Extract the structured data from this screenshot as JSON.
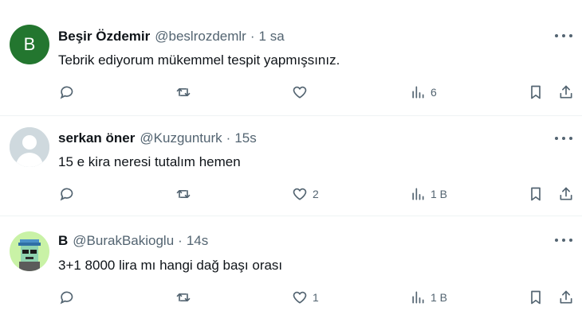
{
  "tweets": [
    {
      "name": "Beşir Özdemir",
      "handle": "@beslrozdemlr",
      "time": "1 sa",
      "text": "Tebrik ediyorum mükemmel tespit yapmışsınız.",
      "avatar_letter": "B",
      "avatar_color": "#23762f",
      "replies": "",
      "retweets": "",
      "likes": "",
      "views": "6"
    },
    {
      "name": "serkan öner",
      "handle": "@Kuzgunturk",
      "time": "15s",
      "text": "15 e kira neresi tutalım hemen",
      "avatar_color": "#cfd9de",
      "replies": "",
      "retweets": "",
      "likes": "2",
      "views": "1 B"
    },
    {
      "name": "B",
      "handle": "@BurakBakioglu",
      "time": "14s",
      "text": "3+1 8000 lira mı hangi dağ başı orası",
      "avatar_color": "#c9f2a6",
      "replies": "",
      "retweets": "",
      "likes": "1",
      "views": "1 B"
    }
  ],
  "icons": {
    "reply": "reply-icon",
    "retweet": "retweet-icon",
    "like": "heart-icon",
    "views": "views-icon",
    "bookmark": "bookmark-icon",
    "share": "share-icon",
    "more": "more-icon"
  },
  "colors": {
    "text": "#0f1419",
    "secondary": "#536471",
    "divider": "#eff3f4"
  }
}
